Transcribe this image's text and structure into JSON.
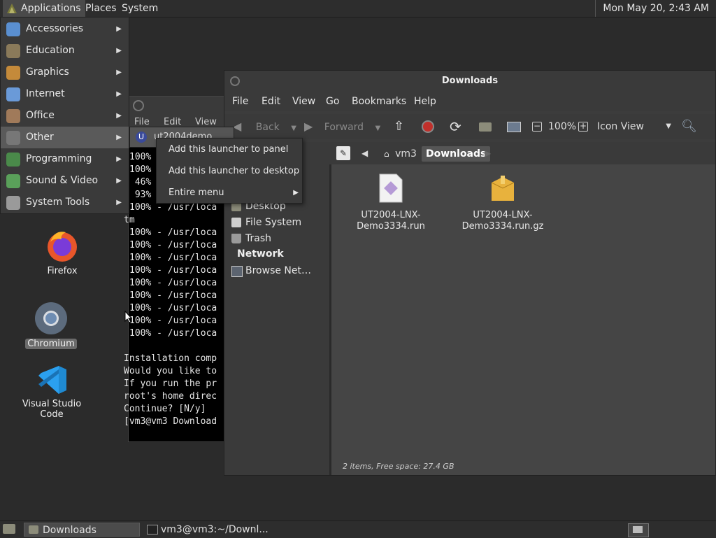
{
  "top_panel": {
    "applications": "Applications",
    "places": "Places",
    "system": "System",
    "clock": "Mon May 20,  2:43 AM"
  },
  "apps_menu": {
    "items": [
      {
        "label": "Accessories",
        "icon": "accessories-icon"
      },
      {
        "label": "Education",
        "icon": "education-icon"
      },
      {
        "label": "Graphics",
        "icon": "graphics-icon"
      },
      {
        "label": "Internet",
        "icon": "internet-icon"
      },
      {
        "label": "Office",
        "icon": "office-icon"
      },
      {
        "label": "Other",
        "icon": "other-icon"
      },
      {
        "label": "Programming",
        "icon": "programming-icon"
      },
      {
        "label": "Sound & Video",
        "icon": "sound-video-icon"
      },
      {
        "label": "System Tools",
        "icon": "system-tools-icon"
      }
    ],
    "submenu_item": "ut2004demo",
    "context": [
      "Add this launcher to panel",
      "Add this launcher to desktop",
      "Entire menu"
    ]
  },
  "desktop": {
    "icons": [
      {
        "label": "Firefox",
        "icon": "firefox-icon"
      },
      {
        "label": "Chromium",
        "icon": "chromium-icon"
      },
      {
        "label": "Visual Studio Code",
        "icon": "vscode-icon"
      }
    ]
  },
  "terminal": {
    "menu": [
      "File",
      "Edit",
      "View"
    ],
    "lines": [
      "100% - /usr/loca",
      "100% - /usr/loca",
      " 46%",
      " 93%",
      "100% - /usr/loca",
      "tm",
      "100% - /usr/loca",
      "100% - /usr/loca",
      "100% - /usr/loca",
      "100% - /usr/loca",
      "100% - /usr/loca",
      "100% - /usr/loca",
      "100% - /usr/loca",
      "100% - /usr/loca",
      "100% - /usr/loca",
      "",
      "Installation comp",
      "Would you like to",
      "If you run the pr",
      "root's home direc",
      "Continue? [N/y]",
      "[vm3@vm3 Download"
    ]
  },
  "file_manager": {
    "title": "Downloads",
    "menu": [
      "File",
      "Edit",
      "View",
      "Go",
      "Bookmarks",
      "Help"
    ],
    "toolbar": {
      "back": "Back",
      "forward": "Forward",
      "zoom": "100%",
      "view": "Icon View"
    },
    "breadcrumb": [
      "vm3",
      "Downloads"
    ],
    "sidebar": {
      "places": [
        "Desktop",
        "File System",
        "Trash"
      ],
      "network_header": "Network",
      "network": [
        "Browse Net…"
      ]
    },
    "files": [
      {
        "name_line1": "UT2004-LNX-",
        "name_line2": "Demo3334.run",
        "icon": "script-file-icon"
      },
      {
        "name_line1": "UT2004-LNX-",
        "name_line2": "Demo3334.run.gz",
        "icon": "archive-file-icon"
      }
    ],
    "status": "2 items, Free space: 27.4 GB"
  },
  "taskbar": {
    "items": [
      "Downloads",
      "vm3@vm3:~/Downl..."
    ]
  }
}
